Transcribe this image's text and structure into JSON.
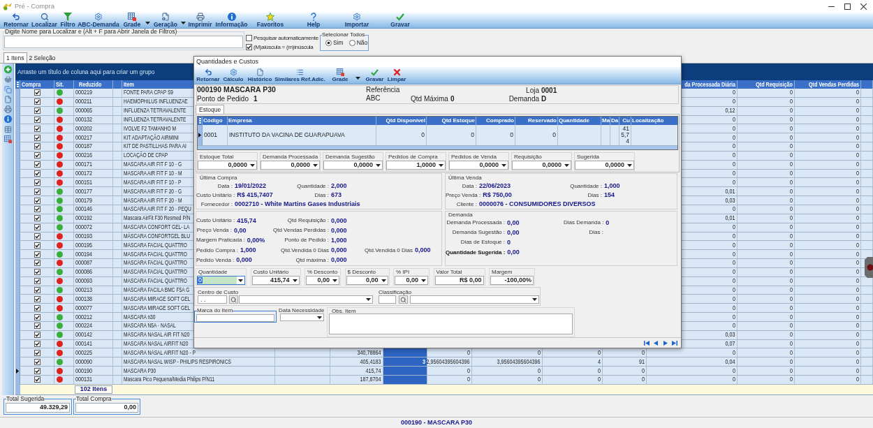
{
  "window": {
    "title": "Pré - Compra"
  },
  "toolbar": [
    {
      "label": "Retornar",
      "dropdown": false
    },
    {
      "label": "Localizar",
      "dropdown": false
    },
    {
      "label": "Filtro",
      "dropdown": false
    },
    {
      "label": "ABC-Demanda",
      "dropdown": false
    },
    {
      "label": "Grade",
      "dropdown": true
    },
    {
      "label": "Geração",
      "dropdown": true
    },
    {
      "label": "Imprimir",
      "dropdown": false
    },
    {
      "label": "Informação",
      "dropdown": false
    },
    {
      "label": "Favoritos",
      "dropdown": false
    },
    {
      "label": "Help",
      "dropdown": false
    },
    {
      "label": "Importar",
      "dropdown": false
    },
    {
      "label": "Gravar",
      "dropdown": false
    }
  ],
  "search": {
    "legend": "Digite Nome para Localizar e (Alt + F para Abrir Janela de Filtros)"
  },
  "options": [
    {
      "label": "Pesquisar automaticamente",
      "checked": false
    },
    {
      "label": "(M)aiúscula = (m)inúscula",
      "checked": true
    }
  ],
  "select_all": {
    "legend": "Selecionar Todos",
    "options": [
      {
        "label": "Sim",
        "selected": true
      },
      {
        "label": "Não",
        "selected": false
      }
    ]
  },
  "tabs": [
    {
      "label": "1 Itens",
      "selected": true
    },
    {
      "label": "2 Seleção",
      "selected": false
    }
  ],
  "grid": {
    "group_hint": "Arraste um título de coluna aqui para criar um grupo",
    "columns": [
      "Compra",
      "Sit.",
      "Reduzido",
      "Item",
      "da Processada Diária",
      "Qtd Requisição",
      "Qtd Vendas Perdidas"
    ],
    "rows": [
      {
        "selected": false,
        "compra": true,
        "color": "#3aae3a",
        "reduzido": "000219",
        "item": "FONTE PARA CPAP S9",
        "processada_diaria": "0",
        "qtd_requisicao": "0",
        "qtd_vendas_perdidas": "0"
      },
      {
        "selected": false,
        "compra": true,
        "color": "#e0221f",
        "reduzido": "000211",
        "item": "HAEMOPHILUS INFLUENZAE",
        "processada_diaria": "0",
        "qtd_requisicao": "0",
        "qtd_vendas_perdidas": "0"
      },
      {
        "selected": false,
        "compra": true,
        "color": "#3aae3a",
        "reduzido": "000065",
        "item": "INFLUENZA TETRAVALENTE",
        "processada_diaria": "0,12",
        "qtd_requisicao": "0",
        "qtd_vendas_perdidas": "0"
      },
      {
        "selected": false,
        "compra": true,
        "color": "#e0221f",
        "reduzido": "000132",
        "item": "INFLUENZA TETRAVALENTE",
        "processada_diaria": "0",
        "qtd_requisicao": "0",
        "qtd_vendas_perdidas": "0"
      },
      {
        "selected": false,
        "compra": true,
        "color": "#e0221f",
        "reduzido": "000202",
        "item": "IVOLVE F2 TAMANHO M",
        "processada_diaria": "0",
        "qtd_requisicao": "0",
        "qtd_vendas_perdidas": "0"
      },
      {
        "selected": false,
        "compra": true,
        "color": "#e0221f",
        "reduzido": "000217",
        "item": "KIT ADAPTAÇÃO AIRMINI",
        "processada_diaria": "0",
        "qtd_requisicao": "0",
        "qtd_vendas_perdidas": "0"
      },
      {
        "selected": false,
        "compra": true,
        "color": "#e0221f",
        "reduzido": "000187",
        "item": "KIT DE PASTILLHAS PARA AI",
        "processada_diaria": "0",
        "qtd_requisicao": "0",
        "qtd_vendas_perdidas": "0"
      },
      {
        "selected": false,
        "compra": true,
        "color": "#e0221f",
        "reduzido": "000216",
        "item": "LOCAÇÃO DE CPAP",
        "processada_diaria": "0",
        "qtd_requisicao": "0",
        "qtd_vendas_perdidas": "0"
      },
      {
        "selected": false,
        "compra": true,
        "color": "#e0221f",
        "reduzido": "000171",
        "item": "MASCARA AIR FIT F 10 - G",
        "processada_diaria": "0",
        "qtd_requisicao": "0",
        "qtd_vendas_perdidas": "0"
      },
      {
        "selected": false,
        "compra": true,
        "color": "#e0221f",
        "reduzido": "000172",
        "item": "MASCARA AIR FIT F 10 - M",
        "processada_diaria": "0",
        "qtd_requisicao": "0",
        "qtd_vendas_perdidas": "0"
      },
      {
        "selected": false,
        "compra": true,
        "color": "#e0221f",
        "reduzido": "000151",
        "item": "MASCARA AIR FIT F 10 - P",
        "processada_diaria": "0",
        "qtd_requisicao": "0",
        "qtd_vendas_perdidas": "0"
      },
      {
        "selected": false,
        "compra": true,
        "color": "#3aae3a",
        "reduzido": "000177",
        "item": "MASCARA AIR FIT F 20 - G",
        "processada_diaria": "0,01",
        "qtd_requisicao": "0",
        "qtd_vendas_perdidas": "0"
      },
      {
        "selected": false,
        "compra": true,
        "color": "#3aae3a",
        "reduzido": "000179",
        "item": "MASCARA AIR FIT F 20 - M",
        "processada_diaria": "0,03",
        "qtd_requisicao": "0",
        "qtd_vendas_perdidas": "0"
      },
      {
        "selected": false,
        "compra": true,
        "color": "#3aae3a",
        "reduzido": "000146",
        "item": "MASCARA AIR FIT F 20 - PEQU",
        "processada_diaria": "0",
        "qtd_requisicao": "0",
        "qtd_vendas_perdidas": "0"
      },
      {
        "selected": false,
        "compra": true,
        "color": "#3aae3a",
        "reduzido": "000192",
        "item": "Mascara AirFit F30 Resmed P/N",
        "processada_diaria": "0,01",
        "qtd_requisicao": "0",
        "qtd_vendas_perdidas": "0"
      },
      {
        "selected": false,
        "compra": true,
        "color": "#3aae3a",
        "reduzido": "000072",
        "item": "MASCARA CONFORT GEL- LA",
        "processada_diaria": "0",
        "qtd_requisicao": "0",
        "qtd_vendas_perdidas": "0"
      },
      {
        "selected": false,
        "compra": true,
        "color": "#e0221f",
        "reduzido": "000193",
        "item": "MÁSCARA CONFORTGEL BLU",
        "processada_diaria": "0",
        "qtd_requisicao": "0",
        "qtd_vendas_perdidas": "0"
      },
      {
        "selected": false,
        "compra": true,
        "color": "#e0221f",
        "reduzido": "000195",
        "item": "MASCARA FACIAL QUATTRO",
        "processada_diaria": "0",
        "qtd_requisicao": "0",
        "qtd_vendas_perdidas": "0"
      },
      {
        "selected": false,
        "compra": true,
        "color": "#3aae3a",
        "reduzido": "000194",
        "item": "MASCARA FACIAL QUATTRO",
        "processada_diaria": "0",
        "qtd_requisicao": "0",
        "qtd_vendas_perdidas": "0"
      },
      {
        "selected": false,
        "compra": true,
        "color": "#e0221f",
        "reduzido": "000087",
        "item": "MASCARA FACIAL QUATTRO",
        "processada_diaria": "0",
        "qtd_requisicao": "0",
        "qtd_vendas_perdidas": "0"
      },
      {
        "selected": false,
        "compra": true,
        "color": "#3aae3a",
        "reduzido": "000086",
        "item": "MASCARA FACIAL QUATTRO",
        "processada_diaria": "0",
        "qtd_requisicao": "0",
        "qtd_vendas_perdidas": "0"
      },
      {
        "selected": false,
        "compra": true,
        "color": "#e0221f",
        "reduzido": "000093",
        "item": "MASCARA FACIAL QUATTRO",
        "processada_diaria": "0",
        "qtd_requisicao": "0",
        "qtd_vendas_perdidas": "0"
      },
      {
        "selected": false,
        "compra": true,
        "color": "#3aae3a",
        "reduzido": "000213",
        "item": "MASCARA FACILA BMC F5A G",
        "processada_diaria": "0",
        "qtd_requisicao": "0",
        "qtd_vendas_perdidas": "0"
      },
      {
        "selected": false,
        "compra": true,
        "color": "#e0221f",
        "reduzido": "000138",
        "item": "MASCARA MIRAGE SOFT GEL",
        "processada_diaria": "0",
        "qtd_requisicao": "0",
        "qtd_vendas_perdidas": "0"
      },
      {
        "selected": false,
        "compra": true,
        "color": "#e0221f",
        "reduzido": "000077",
        "item": "MASCARA MIRAGE SOFT GEL",
        "processada_diaria": "0",
        "qtd_requisicao": "0",
        "qtd_vendas_perdidas": "0"
      },
      {
        "selected": false,
        "compra": true,
        "color": "#3aae3a",
        "reduzido": "000212",
        "item": "MASCARA n30",
        "processada_diaria": "0",
        "qtd_requisicao": "0",
        "qtd_vendas_perdidas": "0"
      },
      {
        "selected": false,
        "compra": true,
        "color": "#3aae3a",
        "reduzido": "000224",
        "item": "MASCARA N5A - NASAL",
        "processada_diaria": "0",
        "qtd_requisicao": "0",
        "qtd_vendas_perdidas": "0"
      },
      {
        "selected": false,
        "compra": true,
        "color": "#3aae3a",
        "reduzido": "000142",
        "item": "MASCARA NASAL AIR FIT N20",
        "processada_diaria": "0,03",
        "qtd_requisicao": "0",
        "qtd_vendas_perdidas": "0"
      },
      {
        "selected": false,
        "compra": true,
        "color": "#e0221f",
        "reduzido": "000141",
        "item": "MASCARA NASAL AIRFIT N20",
        "processada_diaria": "0,07",
        "qtd_requisicao": "0",
        "qtd_vendas_perdidas": "0"
      },
      {
        "selected": false,
        "compra": true,
        "color": "#e0221f",
        "reduzido": "000225",
        "item": "MASCARA NASAL AIRFIT N20 - P",
        "column_7": "340,78864",
        "column_9": "0",
        "column_10": "0",
        "column_11": "0",
        "column_12": "0",
        "processada_diaria": "0",
        "qtd_requisicao": "0",
        "qtd_vendas_perdidas": "0"
      },
      {
        "selected": false,
        "compra": true,
        "color": "#3aae3a",
        "reduzido": "000090",
        "item": "MASCARA NASAL WISP - PHILIPS RESPIRONICS",
        "column_7": "405,4183",
        "column_8": "3",
        "column_9": "2,95604395604396",
        "column_10": "3,95604395604396",
        "column_11": "4",
        "column_12": "91",
        "processada_diaria": "0,04",
        "qtd_requisicao": "0",
        "qtd_vendas_perdidas": "0"
      },
      {
        "selected": true,
        "compra": true,
        "color": "#e0221f",
        "reduzido": "000190",
        "item": "MASCARA P30",
        "column_7": "415,74",
        "column_9": "0",
        "column_10": "0",
        "column_11": "0",
        "column_12": "0",
        "processada_diaria": "0",
        "qtd_requisicao": "0",
        "qtd_vendas_perdidas": "0"
      },
      {
        "selected": false,
        "compra": true,
        "color": "#e0221f",
        "reduzido": "000131",
        "item": "Mascara Pico Pequena/Media Philips P/N11",
        "column_7": "187,8704",
        "column_9": "0",
        "column_10": "0",
        "column_11": "0",
        "column_12": "0",
        "processada_diaria": "0",
        "qtd_requisicao": "0",
        "qtd_vendas_perdidas": "0"
      }
    ],
    "footer_count": "102 Itens"
  },
  "totals": [
    {
      "label": "Total Sugerida",
      "value": "49.329,29"
    },
    {
      "label": "Total Compra",
      "value": "0,00"
    }
  ],
  "status_bar": "000190 - MASCARA P30",
  "dialog": {
    "title": "Quantidades e Custos",
    "toolbar": [
      {
        "label": "Retornar",
        "dropdown": false
      },
      {
        "label": "Cálculo",
        "dropdown": false
      },
      {
        "label": "Histórico",
        "dropdown": false
      },
      {
        "label": "Similares Ref.Adic.",
        "dropdown": false
      },
      {
        "label": "Grade",
        "dropdown": true
      },
      {
        "label": "Gravar",
        "dropdown": false
      },
      {
        "label": "Limpar",
        "dropdown": false
      }
    ],
    "product": {
      "name": "000190 MASCARA P30",
      "referencia": {
        "label": "Referência"
      },
      "loja": {
        "label": "Loja",
        "value": "0001"
      },
      "ponto_de_pedido": {
        "label": "Ponto de Pedido",
        "value": "1"
      },
      "abc": {
        "label": "ABC"
      },
      "qtd_maxima": {
        "label": "Qtd Máxima",
        "value": "0"
      },
      "demanda": {
        "label": "Demanda",
        "value": "D"
      }
    },
    "tabs": [
      {
        "label": "Estoque",
        "selected": true
      }
    ],
    "stock_grid": {
      "columns": [
        "Código",
        "Empresa",
        "Qtd Disponível",
        "Qtd Estoque",
        "Comprado",
        "Reservado",
        "Quantidade",
        "Ma",
        "Da",
        "Cu",
        "Localização"
      ],
      "rows": [
        {
          "selected": true,
          "codigo": "0001",
          "empresa": "INSTITUTO DA VACINA DE GUARAPUAVA",
          "qtd_disponivel": "0",
          "qtd_estoque": "0",
          "comprado": "0",
          "reservado": "0",
          "cu": "415,74"
        }
      ]
    },
    "totals": [
      {
        "label": "Estoque Total",
        "value": "0,0000"
      },
      {
        "label": "Demanda Processada",
        "value": "0,0000"
      },
      {
        "label": "Demanda Sugestão",
        "value": "0,0000"
      },
      {
        "label": "Pedidos de Compra",
        "value": "1,0000"
      },
      {
        "label": "Pedidos de Venda",
        "value": "0,0000"
      },
      {
        "label": "Requisição",
        "value": "0,0000"
      },
      {
        "label": "Sugerida",
        "value": "0,0000"
      }
    ],
    "ultima_compra": {
      "title": "Última Compra",
      "rows": [
        [
          {
            "label": "Data :",
            "value": "19/01/2022"
          },
          {
            "label": "Quantidade :",
            "value": "2,000"
          }
        ],
        [
          {
            "label": "Custo Unitário :",
            "value": "R$ 415,7407"
          },
          {
            "label": "Dias :",
            "value": "673"
          }
        ],
        [
          {
            "label": "Fornecedor :",
            "value": "0002710 - White Martins Gases Industriais"
          }
        ]
      ]
    },
    "ultima_venda": {
      "title": "Última Venda",
      "rows": [
        [
          {
            "label": "Data :",
            "value": "22/06/2023"
          },
          {
            "label": "Quantidade :",
            "value": "1,000"
          }
        ],
        [
          {
            "label": "Preço Venda :",
            "value": "R$ 750,00"
          },
          {
            "label": "Dias :",
            "value": "154"
          }
        ],
        [
          {
            "label": "Cliente :",
            "value": "0000076 - CONSUMIDORES DIVERSOS"
          }
        ]
      ]
    },
    "indicadores": {
      "rows": [
        [
          {
            "label": "Custo Unitário :",
            "value": "415,74"
          },
          {
            "label": "Qtd Requisição :",
            "value": "0,000"
          }
        ],
        [
          {
            "label": "Preço Venda :",
            "value": "0,00"
          },
          {
            "label": "Qtd Vendas Perdidas :",
            "value": "0,000"
          }
        ],
        [
          {
            "label": "Margem Praticada :",
            "value": "0,00%"
          },
          {
            "label": "Ponto de Pedido :",
            "value": "1,000"
          }
        ],
        [
          {
            "label": "Pedido Compra :",
            "value": "1,000"
          },
          {
            "label": "Qtd.Vendida 0 Dias",
            "value": "0,000"
          },
          {
            "label": "Qtd.Vendida 0 Dias",
            "value": "0,000"
          }
        ],
        [
          {
            "label": "Pedido Venda :",
            "value": "0,000"
          },
          {
            "label": "Qtd máxima :",
            "value": "0,000"
          }
        ]
      ]
    },
    "demanda": {
      "title": "Demanda",
      "rows": [
        [
          {
            "kind": "field",
            "label": "Demanda Processada :",
            "value": "0,00"
          },
          {
            "kind": "field",
            "label": "Dias Demanda :",
            "value": "0"
          }
        ],
        [
          {
            "kind": "field",
            "label": "Demanda Sugestão :",
            "value": "0,00"
          },
          {
            "kind": "field",
            "label": "Dias :"
          }
        ],
        [
          {
            "kind": "field",
            "label": "Dias de Estoque :",
            "value": "0"
          }
        ],
        [
          {
            "kind": "total",
            "label": "Quantidade Sugerida :",
            "value": "0,00"
          }
        ]
      ]
    },
    "entry": [
      {
        "kind": "combo",
        "label": "Quantidade",
        "value": "0",
        "focused": true
      },
      {
        "kind": "combo",
        "label": "Custo Unitário",
        "value": "415,74",
        "focused": false
      },
      {
        "kind": "combo",
        "label": "% Desconto",
        "value": "0,00",
        "focused": false
      },
      {
        "kind": "combo",
        "label": "$ Desconto",
        "value": "0,00",
        "focused": false
      },
      {
        "kind": "combo",
        "label": "% IPI",
        "value": "0,00",
        "focused": false
      },
      {
        "kind": "text",
        "label": "Valor Total",
        "value": "R$ 0,00",
        "focused": false
      },
      {
        "kind": "text",
        "label": "Margem",
        "value": "-100,00%",
        "focused": false
      }
    ],
    "lookups": [
      {
        "label": "Centro de Custo",
        "code": ". ."
      },
      {
        "label": "Classificação"
      }
    ],
    "marca": {
      "label": "Marca do Item",
      "focused": true
    },
    "data_necessidade": {
      "label": "Data Necessidade"
    },
    "obs": {
      "label": "Obs. Item"
    }
  }
}
